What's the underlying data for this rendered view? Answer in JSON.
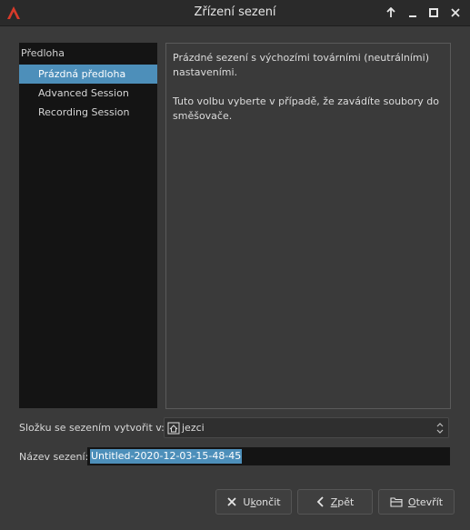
{
  "window": {
    "title": "Zřízení sezení",
    "accent": "#4d8fba"
  },
  "templates": {
    "group_label": "Předloha",
    "items": [
      {
        "label": "Prázdná předloha",
        "selected": true
      },
      {
        "label": "Advanced Session",
        "selected": false
      },
      {
        "label": "Recording Session",
        "selected": false
      }
    ]
  },
  "description": {
    "line1": "Prázdné sezení s výchozími továrními (neutrálními) nastaveními.",
    "line2": "Tuto volbu vyberte v případě, že zavádíte soubory do směšovače."
  },
  "folder": {
    "label": "Složku se sezením vytvořit v:",
    "value": "jezci"
  },
  "session_name": {
    "label": "Název sezení:",
    "value": "Untitled-2020-12-03-15-48-45"
  },
  "buttons": {
    "quit": {
      "first": "U",
      "mnemonic": "k",
      "rest": "ončit"
    },
    "back": {
      "mnemonic": "Z",
      "rest": "pět"
    },
    "open": {
      "mnemonic": "O",
      "rest": "tevřít"
    }
  }
}
